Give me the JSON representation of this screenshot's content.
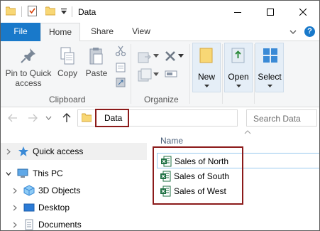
{
  "window": {
    "title": "Data"
  },
  "quick_access_toolbar": {
    "items": [
      "folder-icon",
      "properties-icon",
      "new-folder-icon",
      "customize-dropdown-icon"
    ]
  },
  "window_controls": [
    "minimize",
    "maximize",
    "close"
  ],
  "ribbon_tabs": {
    "file": "File",
    "home": "Home",
    "share": "Share",
    "view": "View",
    "active": "Home",
    "help": "?"
  },
  "ribbon": {
    "clipboard": {
      "label": "Clipboard",
      "pin_label_line1": "Pin to Quick",
      "pin_label_line2": "access",
      "copy_label": "Copy",
      "paste_label": "Paste"
    },
    "organize": {
      "label": "Organize"
    },
    "new_label": "New",
    "open_label": "Open",
    "select_label": "Select"
  },
  "address_bar": {
    "crumb": "Data",
    "search_placeholder": "Search Data"
  },
  "nav_pane": {
    "quick_access": "Quick access",
    "this_pc": "This PC",
    "items": [
      "3D Objects",
      "Desktop",
      "Documents"
    ]
  },
  "file_list": {
    "column_name": "Name",
    "files": [
      "Sales of North",
      "Sales of South",
      "Sales of West"
    ]
  },
  "colors": {
    "accent": "#1979ca",
    "highlight_border": "#8b1a1a",
    "excel_green": "#1d6f42"
  }
}
